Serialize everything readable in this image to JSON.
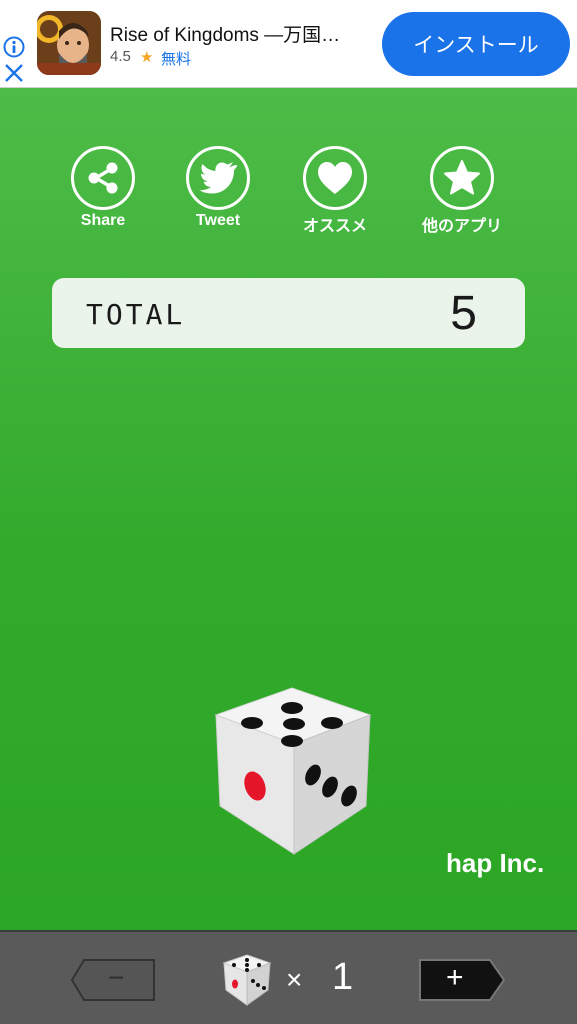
{
  "ad": {
    "title": "Rise of Kingdoms —万国…",
    "rating": "4.5",
    "star": "★",
    "price": "無料",
    "install_label": "インストール"
  },
  "share_buttons": [
    {
      "label": "Share",
      "icon": "share-icon"
    },
    {
      "label": "Tweet",
      "icon": "twitter-bird-icon"
    },
    {
      "label": "オススメ",
      "icon": "heart-icon"
    },
    {
      "label": "他のアプリ",
      "icon": "star-icon"
    }
  ],
  "total": {
    "label": "TOTAL",
    "value": "5"
  },
  "brand": "hap Inc.",
  "bottom": {
    "minus_label": "−",
    "plus_label": "+",
    "times": "×",
    "dice_count": "1"
  },
  "colors": {
    "background_green": "#3aac35",
    "install_blue": "#1a73e8",
    "bottom_bar": "#5a5a5a"
  }
}
